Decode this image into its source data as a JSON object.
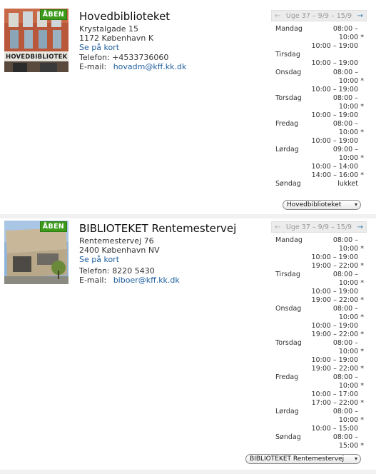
{
  "libraries": [
    {
      "badge": "ÅBEN",
      "photo_sign": "HOVEDBIBLIOTEK",
      "name": "Hovedbiblioteket",
      "street": "Krystalgade 15",
      "city": "1172 København K",
      "map_link": "Se på kort",
      "phone": "Telefon: +4533736060",
      "email_label": "E-mail:",
      "email": "hovadm@kff.kk.dk",
      "week": "Uge 37 – 9/9 – 15/9",
      "select_value": "Hovedbiblioteket",
      "schedule": [
        {
          "day": "Mandag",
          "times": [
            "08:00 –",
            "10:00 *",
            "10:00 – 19:00"
          ]
        },
        {
          "day": "Tirsdag",
          "times": [
            "10:00 – 19:00"
          ]
        },
        {
          "day": "Onsdag",
          "times": [
            "08:00 –",
            "10:00 *",
            "10:00 – 19:00"
          ]
        },
        {
          "day": "Torsdag",
          "times": [
            "08:00 –",
            "10:00 *",
            "10:00 – 19:00"
          ]
        },
        {
          "day": "Fredag",
          "times": [
            "08:00 –",
            "10:00 *",
            "10:00 – 19:00"
          ]
        },
        {
          "day": "Lørdag",
          "times": [
            "09:00 –",
            "10:00 *",
            "10:00 – 14:00",
            "14:00 – 16:00 *"
          ]
        },
        {
          "day": "Søndag",
          "times": [
            "lukket"
          ]
        }
      ]
    },
    {
      "badge": "ÅBEN",
      "name": "BIBLIOTEKET Rentemestervej",
      "street": "Rentemestervej 76",
      "city": "2400 København NV",
      "map_link": "Se på kort",
      "phone": "Telefon: 8220 5430",
      "email_label": "E-mail:",
      "email": "biboer@kff.kk.dk",
      "week": "Uge 37 – 9/9 – 15/9",
      "select_value": "BIBLIOTEKET Rentemestervej",
      "schedule": [
        {
          "day": "Mandag",
          "times": [
            "08:00 –",
            "10:00 *",
            "10:00 – 19:00",
            "19:00 – 22:00 *"
          ]
        },
        {
          "day": "Tirsdag",
          "times": [
            "08:00 –",
            "10:00 *",
            "10:00 – 19:00",
            "19:00 – 22:00 *"
          ]
        },
        {
          "day": "Onsdag",
          "times": [
            "08:00 –",
            "10:00 *",
            "10:00 – 19:00",
            "19:00 – 22:00 *"
          ]
        },
        {
          "day": "Torsdag",
          "times": [
            "08:00 –",
            "10:00 *",
            "10:00 – 19:00",
            "19:00 – 22:00 *"
          ]
        },
        {
          "day": "Fredag",
          "times": [
            "08:00 –",
            "10:00 *",
            "10:00 – 17:00",
            "17:00 – 22:00 *"
          ]
        },
        {
          "day": "Lørdag",
          "times": [
            "08:00 –",
            "10:00 *",
            "10:00 – 15:00"
          ]
        },
        {
          "day": "Søndag",
          "times": [
            "08:00 –",
            "15:00 *"
          ]
        }
      ]
    }
  ],
  "nav": {
    "prev_arrow": "←",
    "next_arrow": "→",
    "caret": "▾"
  },
  "colors": {
    "badge_green": "#3c9a1a",
    "link_blue": "#1f5f9f",
    "nav_bg": "#ececec"
  }
}
